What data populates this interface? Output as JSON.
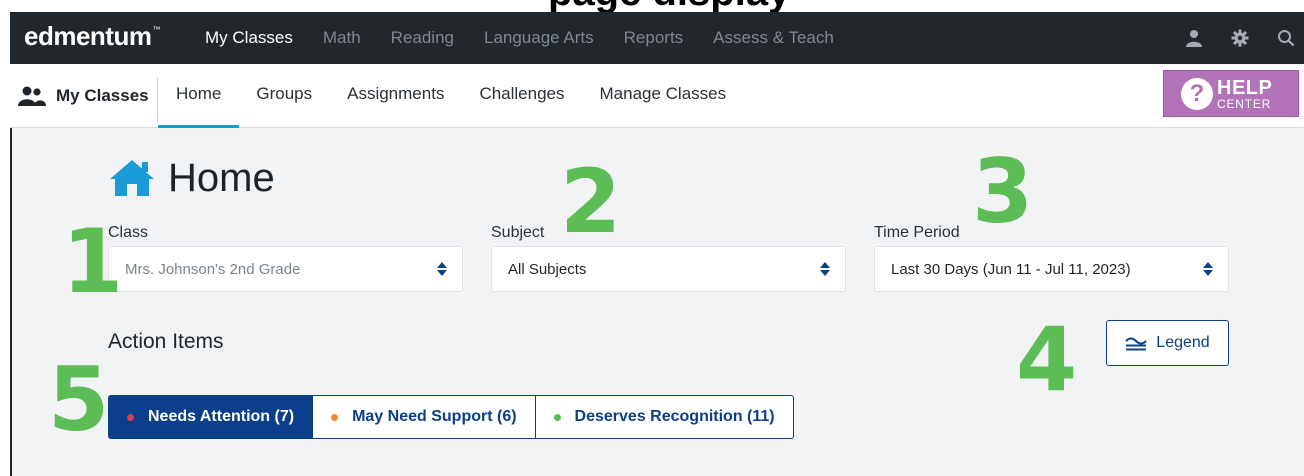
{
  "colors": {
    "topbar_bg": "#22272b",
    "accent": "#1a9ad6",
    "primary": "#0b3f8c",
    "help_bg": "#b373b9",
    "annotation": "#5cbc55",
    "needs_attention": "#e23b4a",
    "may_need_support": "#f08a2c",
    "deserves_recognition": "#5cbc55"
  },
  "topbar": {
    "logo": "edmentum",
    "logo_tm": "™",
    "nav": [
      "My Classes",
      "Math",
      "Reading",
      "Language Arts",
      "Reports",
      "Assess & Teach"
    ],
    "active_nav": "My Classes",
    "icons": [
      "user-icon",
      "gear-icon",
      "search-icon"
    ]
  },
  "subnav": {
    "title": "My Classes",
    "tabs": [
      "Home",
      "Groups",
      "Assignments",
      "Challenges",
      "Manage Classes"
    ],
    "active_tab": "Home",
    "help": {
      "line1": "HELP",
      "line2": "CENTER",
      "symbol": "?"
    }
  },
  "page": {
    "title": "Home",
    "icon": "home-icon"
  },
  "filters": {
    "class": {
      "label": "Class",
      "value": "Mrs. Johnson's 2nd Grade"
    },
    "subject": {
      "label": "Subject",
      "value": "All Subjects"
    },
    "time_period": {
      "label": "Time Period",
      "value": "Last 30 Days (Jun 11 - Jul 11, 2023)"
    }
  },
  "action_items": {
    "title": "Action Items",
    "legend_label": "Legend",
    "tabs": [
      {
        "label": "Needs Attention (7)",
        "active": true
      },
      {
        "label": "May Need Support (6)",
        "active": false
      },
      {
        "label": "Deserves Recognition (11)",
        "active": false
      }
    ]
  },
  "annotations": [
    "1",
    "2",
    "3",
    "4",
    "5"
  ]
}
